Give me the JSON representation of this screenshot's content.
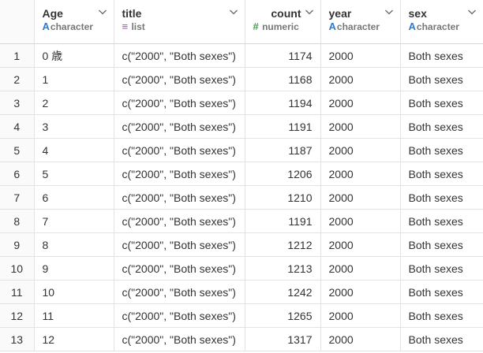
{
  "columns": {
    "age": {
      "name": "Age",
      "type": "character",
      "icon": "A"
    },
    "title": {
      "name": "title",
      "type": "list",
      "icon": "≡"
    },
    "count": {
      "name": "count",
      "type": "numeric",
      "icon": "#"
    },
    "year": {
      "name": "year",
      "type": "character",
      "icon": "A"
    },
    "sex": {
      "name": "sex",
      "type": "character",
      "icon": "A"
    }
  },
  "rows": [
    {
      "n": "1",
      "age": "0 歳",
      "title": "c(\"2000\", \"Both sexes\")",
      "count": "1174",
      "year": "2000",
      "sex": "Both sexes"
    },
    {
      "n": "2",
      "age": "1",
      "title": "c(\"2000\", \"Both sexes\")",
      "count": "1168",
      "year": "2000",
      "sex": "Both sexes"
    },
    {
      "n": "3",
      "age": "2",
      "title": "c(\"2000\", \"Both sexes\")",
      "count": "1194",
      "year": "2000",
      "sex": "Both sexes"
    },
    {
      "n": "4",
      "age": "3",
      "title": "c(\"2000\", \"Both sexes\")",
      "count": "1191",
      "year": "2000",
      "sex": "Both sexes"
    },
    {
      "n": "5",
      "age": "4",
      "title": "c(\"2000\", \"Both sexes\")",
      "count": "1187",
      "year": "2000",
      "sex": "Both sexes"
    },
    {
      "n": "6",
      "age": "5",
      "title": "c(\"2000\", \"Both sexes\")",
      "count": "1206",
      "year": "2000",
      "sex": "Both sexes"
    },
    {
      "n": "7",
      "age": "6",
      "title": "c(\"2000\", \"Both sexes\")",
      "count": "1210",
      "year": "2000",
      "sex": "Both sexes"
    },
    {
      "n": "8",
      "age": "7",
      "title": "c(\"2000\", \"Both sexes\")",
      "count": "1191",
      "year": "2000",
      "sex": "Both sexes"
    },
    {
      "n": "9",
      "age": "8",
      "title": "c(\"2000\", \"Both sexes\")",
      "count": "1212",
      "year": "2000",
      "sex": "Both sexes"
    },
    {
      "n": "10",
      "age": "9",
      "title": "c(\"2000\", \"Both sexes\")",
      "count": "1213",
      "year": "2000",
      "sex": "Both sexes"
    },
    {
      "n": "11",
      "age": "10",
      "title": "c(\"2000\", \"Both sexes\")",
      "count": "1242",
      "year": "2000",
      "sex": "Both sexes"
    },
    {
      "n": "12",
      "age": "11",
      "title": "c(\"2000\", \"Both sexes\")",
      "count": "1265",
      "year": "2000",
      "sex": "Both sexes"
    },
    {
      "n": "13",
      "age": "12",
      "title": "c(\"2000\", \"Both sexes\")",
      "count": "1317",
      "year": "2000",
      "sex": "Both sexes"
    }
  ]
}
